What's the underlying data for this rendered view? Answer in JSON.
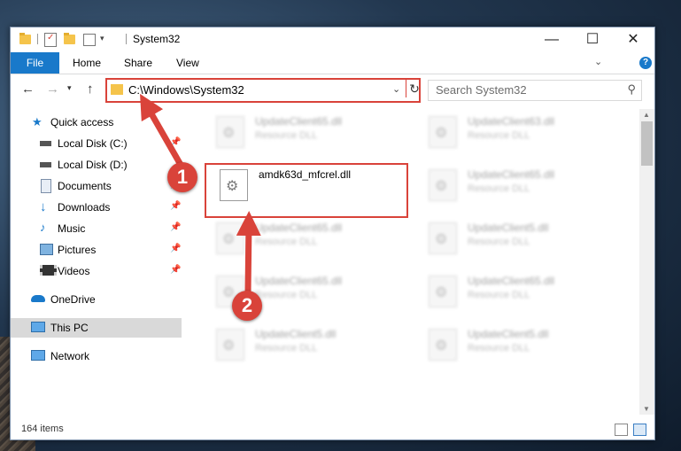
{
  "window": {
    "title": "System32",
    "controls": {
      "minimize": "—",
      "maximize": "☐",
      "close": "✕"
    }
  },
  "ribbon": {
    "tabs": [
      {
        "label": "File"
      },
      {
        "label": "Home"
      },
      {
        "label": "Share"
      },
      {
        "label": "View"
      }
    ],
    "help": "?"
  },
  "address": {
    "path": "C:\\Windows\\System32",
    "search_placeholder": "Search System32"
  },
  "sidebar": {
    "items": [
      {
        "label": "Quick access",
        "icon": "star-icon"
      },
      {
        "label": "Local Disk (C:)",
        "icon": "drive-icon",
        "pinned": true
      },
      {
        "label": "Local Disk (D:)",
        "icon": "drive-icon"
      },
      {
        "label": "Documents",
        "icon": "documents-icon",
        "pinned": true
      },
      {
        "label": "Downloads",
        "icon": "download-icon",
        "pinned": true
      },
      {
        "label": "Music",
        "icon": "music-icon",
        "pinned": true
      },
      {
        "label": "Pictures",
        "icon": "pictures-icon",
        "pinned": true
      },
      {
        "label": "Videos",
        "icon": "video-icon",
        "pinned": true
      },
      {
        "label": "OneDrive",
        "icon": "cloud-icon"
      },
      {
        "label": "This PC",
        "icon": "computer-icon",
        "selected": true
      },
      {
        "label": "Network",
        "icon": "network-icon"
      }
    ]
  },
  "files": [
    {
      "name": "UpdateClient65.dll",
      "type": "Resource DLL"
    },
    {
      "name": "UpdateClient63.dll",
      "type": "Resource DLL"
    },
    {
      "name": "amdk63d_mfcrel.dll",
      "type": ""
    },
    {
      "name": "UpdateClient65.dll",
      "type": "Resource DLL"
    },
    {
      "name": "UpdateClient65.dll",
      "type": "Resource DLL"
    },
    {
      "name": "UpdateClient5.dll",
      "type": "Resource DLL"
    },
    {
      "name": "UpdateClient65.dll",
      "type": "Resource DLL"
    },
    {
      "name": "UpdateClient65.dll",
      "type": "Resource DLL"
    },
    {
      "name": "UpdateClient5.dll",
      "type": "Resource DLL"
    },
    {
      "name": "UpdateClient5.dll",
      "type": "Resource DLL"
    }
  ],
  "status": {
    "count": "164 items"
  },
  "annotations": {
    "step1": "1",
    "step2": "2"
  },
  "colors": {
    "accent": "#1979ca",
    "annotation": "#d9433a",
    "folder": "#f5c44b"
  }
}
